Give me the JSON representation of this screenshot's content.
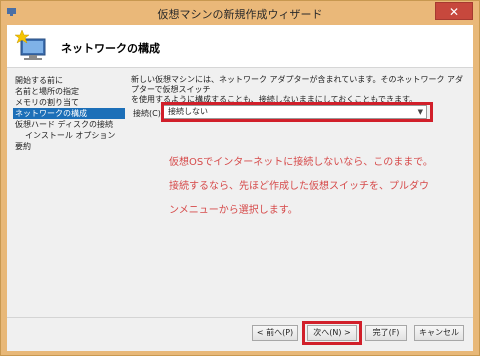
{
  "window": {
    "title": "仮想マシンの新規作成ウィザード",
    "close_glyph": "✕"
  },
  "header": {
    "title": "ネットワークの構成",
    "icon": "computer-star-icon"
  },
  "nav": {
    "items": [
      {
        "label": "開始する前に",
        "active": false,
        "sub": false
      },
      {
        "label": "名前と場所の指定",
        "active": false,
        "sub": false
      },
      {
        "label": "メモリの割り当て",
        "active": false,
        "sub": false
      },
      {
        "label": "ネットワークの構成",
        "active": true,
        "sub": false
      },
      {
        "label": "仮想ハード ディスクの接続",
        "active": false,
        "sub": false
      },
      {
        "label": "インストール オプション",
        "active": false,
        "sub": true
      },
      {
        "label": "要約",
        "active": false,
        "sub": false
      }
    ]
  },
  "content": {
    "description": "新しい仮想マシンには、ネットワーク アダプターが含まれています。そのネットワーク アダプターで仮想スイッチ\nを使用するように構成することも、接続しないままにしておくこともできます。",
    "connection_label": "接続(C):",
    "connection_value": "接続しない"
  },
  "annotations": {
    "line1": "仮想OSでインターネットに接続しないなら、このままで。",
    "line2": "接続するなら、先ほど作成した仮想スイッチを、プルダウ",
    "line3": "ンメニューから選択します。",
    "color": "#d64a4a",
    "highlight_color": "#d11f2a"
  },
  "buttons": {
    "back": "< 前へ(P)",
    "next": "次へ(N) >",
    "finish": "完了(F)",
    "cancel": "キャンセル"
  },
  "colors": {
    "title_bar": "#eab879",
    "nav_active": "#1c6fb8"
  }
}
